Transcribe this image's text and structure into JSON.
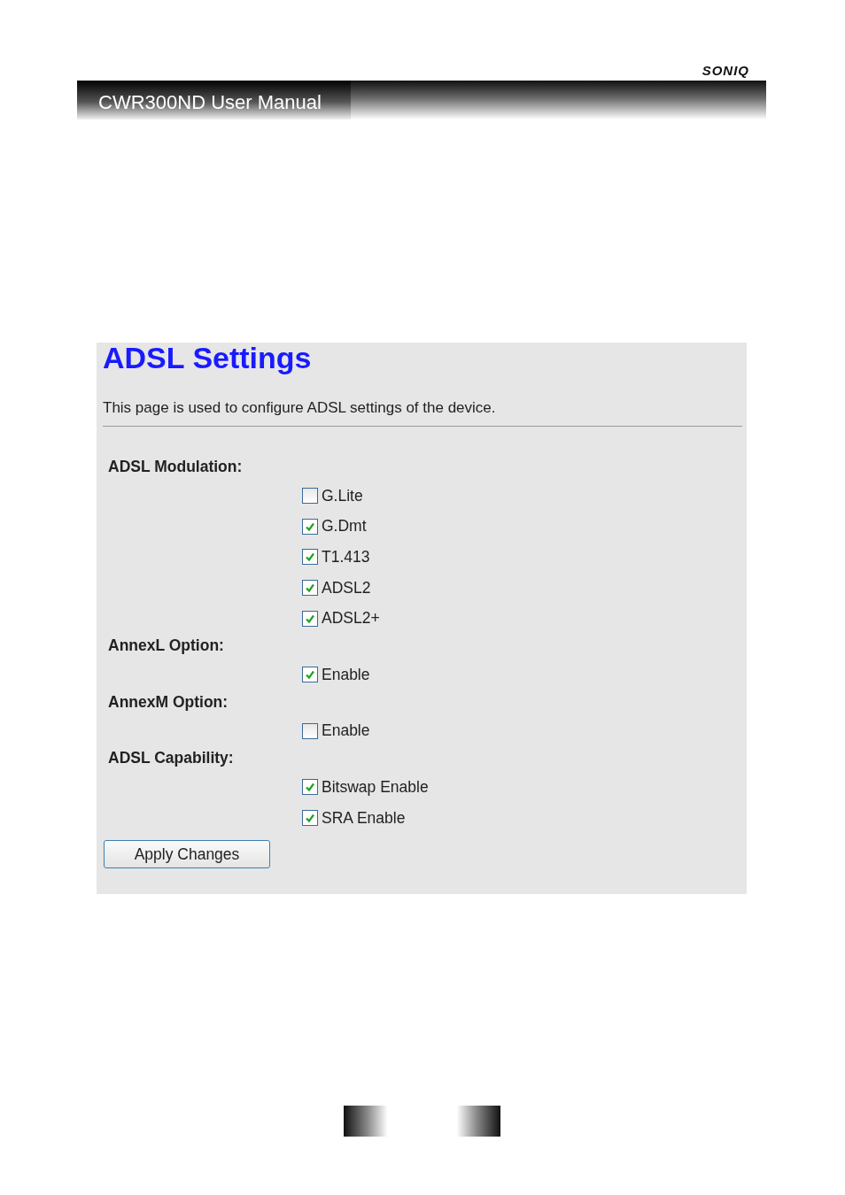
{
  "brand": "SONIQ",
  "header": {
    "title": "CWR300ND User Manual"
  },
  "panel": {
    "title": "ADSL Settings",
    "description": "This page is used to configure ADSL settings of the device.",
    "groups": [
      {
        "label": "ADSL Modulation:",
        "options": [
          {
            "label": "G.Lite",
            "checked": false
          },
          {
            "label": "G.Dmt",
            "checked": true
          },
          {
            "label": "T1.413",
            "checked": true
          },
          {
            "label": "ADSL2",
            "checked": true
          },
          {
            "label": "ADSL2+",
            "checked": true
          }
        ]
      },
      {
        "label": "AnnexL Option:",
        "options": [
          {
            "label": "Enable",
            "checked": true
          }
        ]
      },
      {
        "label": "AnnexM Option:",
        "options": [
          {
            "label": "Enable",
            "checked": false
          }
        ]
      },
      {
        "label": "ADSL Capability:",
        "options": [
          {
            "label": "Bitswap Enable",
            "checked": true
          },
          {
            "label": "SRA Enable",
            "checked": true
          }
        ]
      }
    ],
    "button": "Apply Changes"
  }
}
